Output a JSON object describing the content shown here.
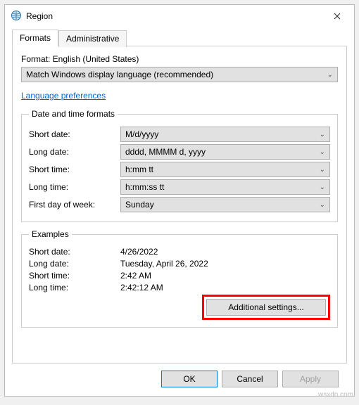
{
  "window": {
    "title": "Region"
  },
  "tabs": {
    "formats": "Formats",
    "administrative": "Administrative"
  },
  "format": {
    "label": "Format: English (United States)",
    "selected": "Match Windows display language (recommended)"
  },
  "link": {
    "lang_prefs": "Language preferences"
  },
  "groups": {
    "datetime": {
      "legend": "Date and time formats",
      "short_date_label": "Short date:",
      "short_date_value": "M/d/yyyy",
      "long_date_label": "Long date:",
      "long_date_value": "dddd, MMMM d, yyyy",
      "short_time_label": "Short time:",
      "short_time_value": "h:mm tt",
      "long_time_label": "Long time:",
      "long_time_value": "h:mm:ss tt",
      "first_day_label": "First day of week:",
      "first_day_value": "Sunday"
    },
    "examples": {
      "legend": "Examples",
      "short_date_label": "Short date:",
      "short_date_value": "4/26/2022",
      "long_date_label": "Long date:",
      "long_date_value": "Tuesday, April 26, 2022",
      "short_time_label": "Short time:",
      "short_time_value": "2:42 AM",
      "long_time_label": "Long time:",
      "long_time_value": "2:42:12 AM"
    }
  },
  "buttons": {
    "additional": "Additional settings...",
    "ok": "OK",
    "cancel": "Cancel",
    "apply": "Apply"
  },
  "watermark": "wsxdn.com"
}
